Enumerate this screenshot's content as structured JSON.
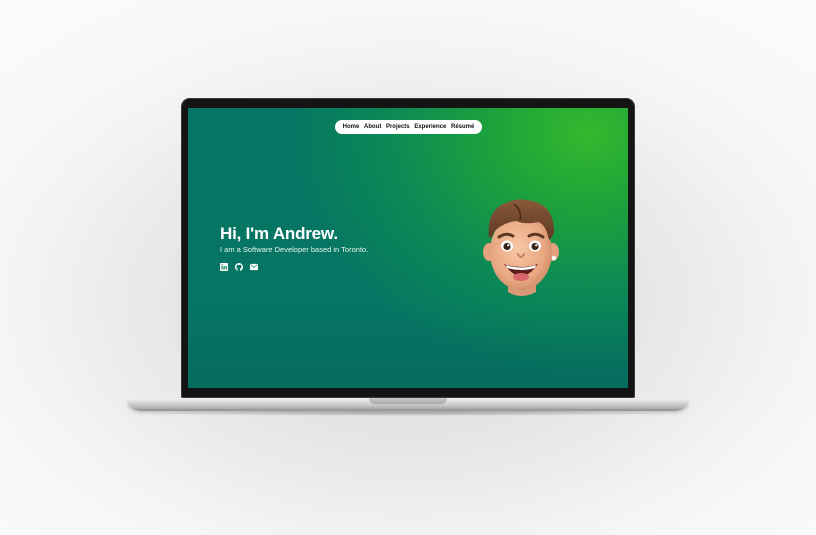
{
  "navbar": {
    "items": [
      {
        "label": "Home"
      },
      {
        "label": "About"
      },
      {
        "label": "Projects"
      },
      {
        "label": "Experience"
      },
      {
        "label": "Résumé"
      }
    ]
  },
  "hero": {
    "title": "Hi, I'm Andrew.",
    "subtitle": "I am a Software Developer based in Toronto."
  },
  "socials": [
    {
      "icon": "linkedin-icon"
    },
    {
      "icon": "github-icon"
    },
    {
      "icon": "mail-icon"
    }
  ],
  "avatar": {
    "icon": "memoji-avatar"
  },
  "colors": {
    "background_green_light": "#33b82e",
    "background_teal_dark": "#067564",
    "navbar_background": "#ffffff",
    "text_primary": "#ffffff"
  }
}
